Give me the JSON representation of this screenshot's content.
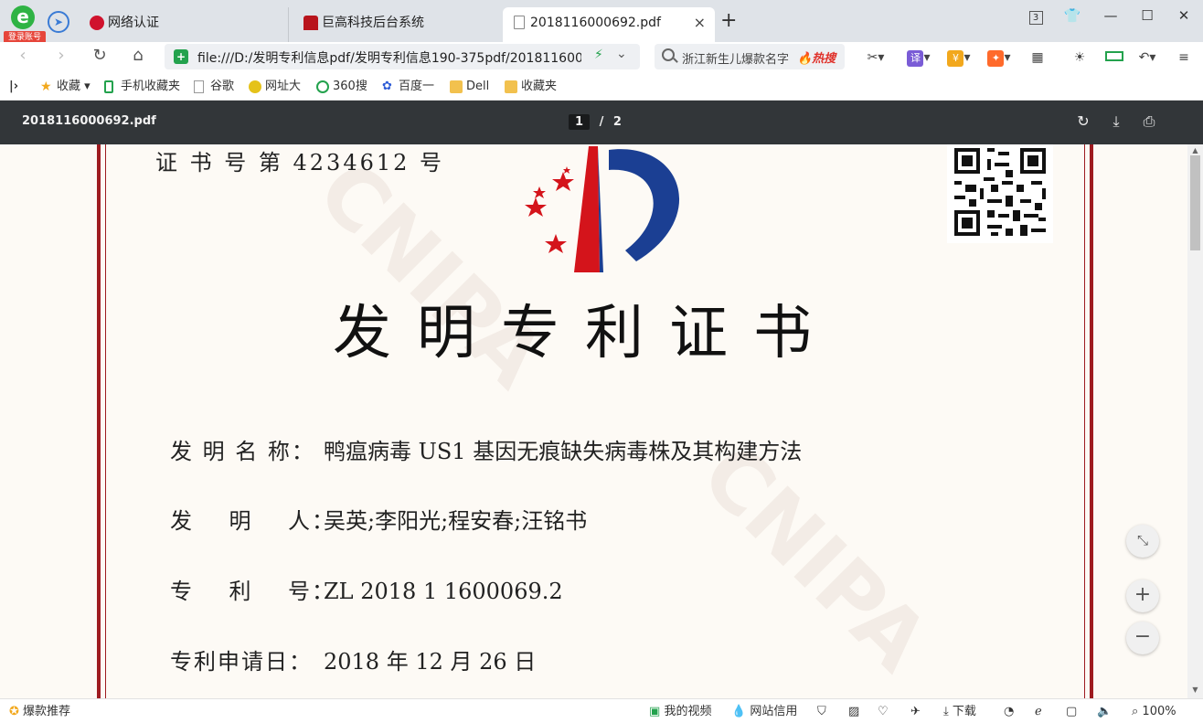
{
  "browser": {
    "login_badge": "登录账号",
    "tabs": [
      {
        "label": "网络认证"
      },
      {
        "label": "巨高科技后台系统"
      },
      {
        "label": "2018116000692.pdf"
      }
    ],
    "new_tab": "+",
    "tab_close": "×",
    "window": {
      "tab_count": "3"
    },
    "address": "file:///D:/发明专利信息pdf/发明专利信息190-375pdf/2018116000692.pdf",
    "search_placeholder": "浙江新生儿爆款名字",
    "search_hot": "🔥热搜"
  },
  "bookmarks": [
    {
      "label": "收藏"
    },
    {
      "label": "手机收藏夹"
    },
    {
      "label": "谷歌"
    },
    {
      "label": "网址大"
    },
    {
      "label": "360搜"
    },
    {
      "label": "百度一"
    },
    {
      "label": "Dell"
    },
    {
      "label": "收藏夹"
    }
  ],
  "pdf": {
    "filename": "2018116000692.pdf",
    "page_current": "1",
    "page_sep": "/",
    "page_total": "2",
    "certificate": {
      "number": "证 书 号 第 4234612 号",
      "title": "发明专利证书",
      "watermark": "CNIPA",
      "fields": [
        {
          "key": "发 明 名 称：",
          "value": "鸭瘟病毒 US1 基因无痕缺失病毒株及其构建方法"
        },
        {
          "key": "发    明    人：",
          "value": "吴英;李阳光;程安春;汪铭书"
        },
        {
          "key": "专    利    号：",
          "value": "ZL 2018 1 1600069.2"
        },
        {
          "key": "专利申请日：",
          "value": "2018 年 12 月 26 日"
        }
      ]
    }
  },
  "status": {
    "recommend": "爆款推荐",
    "video": "我的视频",
    "site_credit": "网站信用",
    "download": "下载",
    "zoom": "100%"
  },
  "colors": {
    "frame_red": "#9e1b20",
    "paper": "#fdfaf5",
    "pdf_toolbar": "#323639"
  }
}
